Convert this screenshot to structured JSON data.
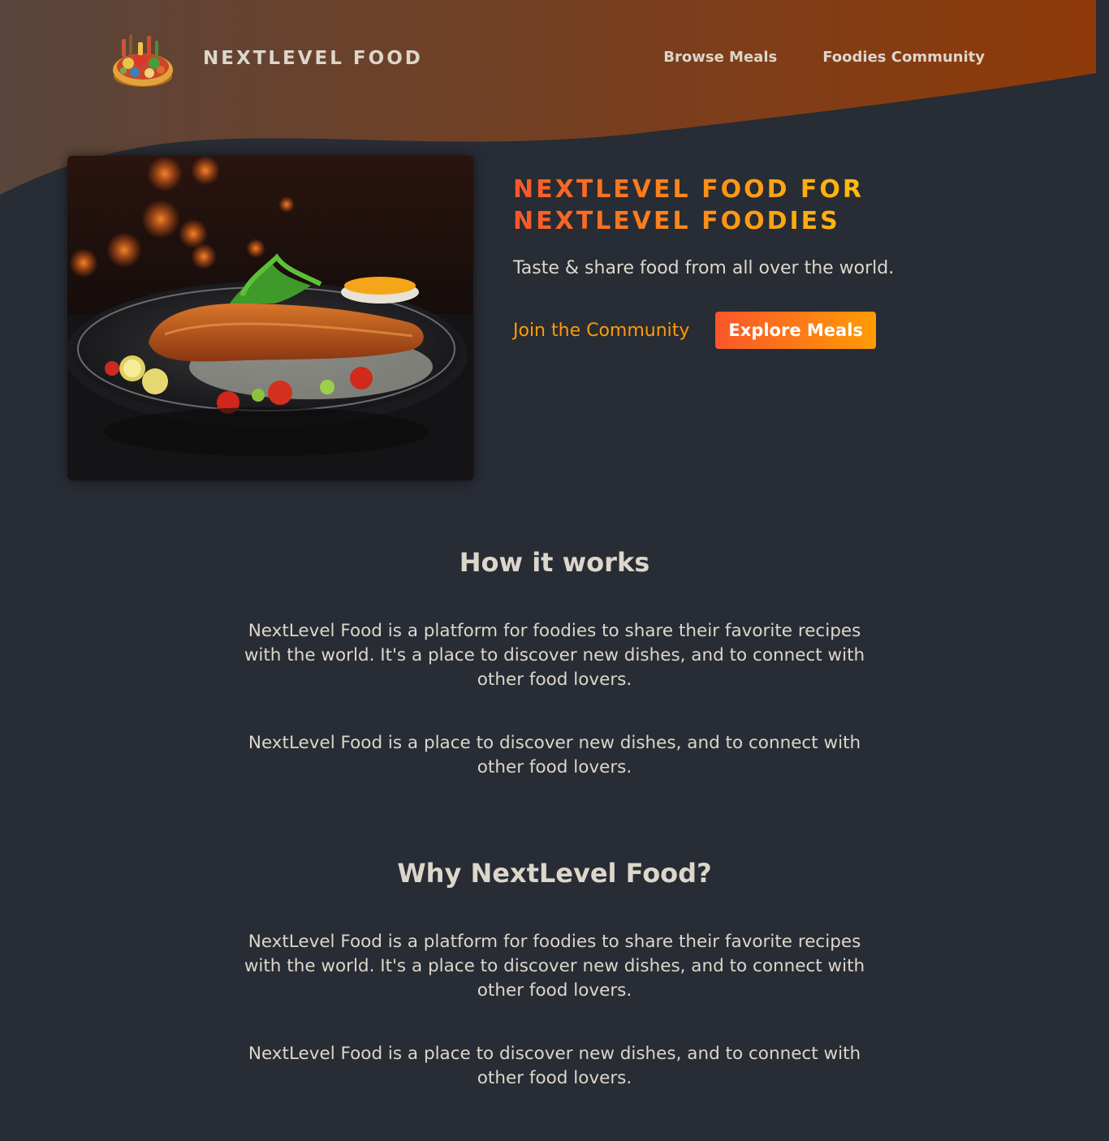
{
  "header": {
    "logo_text": "NEXTLEVEL FOOD",
    "nav": {
      "browse_meals": "Browse Meals",
      "foodies_community": "Foodies Community"
    }
  },
  "hero": {
    "title_line1": "NEXTLEVEL FOOD FOR",
    "title_line2": "NEXTLEVEL FOODIES",
    "subtitle": "Taste & share food from all over the world.",
    "join_link": "Join the Community",
    "explore_button": "Explore Meals"
  },
  "sections": {
    "how": {
      "heading": "How it works",
      "p1": "NextLevel Food is a platform for foodies to share their favorite recipes with the world. It's a place to discover new dishes, and to connect with other food lovers.",
      "p2": "NextLevel Food is a place to discover new dishes, and to connect with other food lovers."
    },
    "why": {
      "heading": "Why NextLevel Food?",
      "p1": "NextLevel Food is a platform for foodies to share their favorite recipes with the world. It's a place to discover new dishes, and to connect with other food lovers.",
      "p2": "NextLevel Food is a place to discover new dishes, and to connect with other food lovers."
    }
  },
  "colors": {
    "background": "#282c34",
    "text": "#ddd6cb",
    "header_gradient_start": "#59453c",
    "header_gradient_end": "#8f3a09",
    "accent_orange": "#f9572a",
    "accent_yellow": "#ffc905",
    "link_orange": "#ff9b05"
  },
  "icons": {
    "logo": "food-platter-icon"
  }
}
